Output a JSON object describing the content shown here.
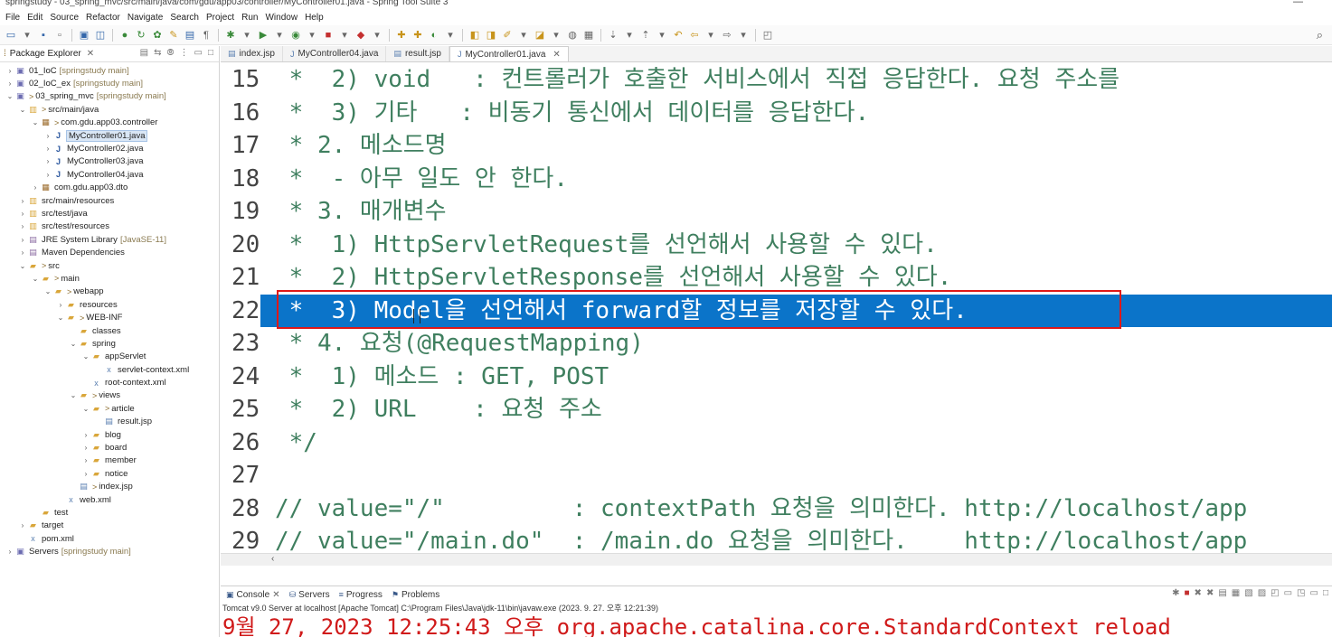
{
  "window": {
    "title": "springstudy - 03_spring_mvc/src/main/java/com/gdu/app03/controller/MyController01.java - Spring Tool Suite 3",
    "minimize": "—"
  },
  "menu": [
    "File",
    "Edit",
    "Source",
    "Refactor",
    "Navigate",
    "Search",
    "Project",
    "Run",
    "Window",
    "Help"
  ],
  "package_explorer": {
    "tab_label": "Package Explorer",
    "items": [
      {
        "label": "01_IoC",
        "meta": "[springstudy main]",
        "icon": "project-icon",
        "twisty": ">",
        "deco": ""
      },
      {
        "label": "02_IoC_ex",
        "meta": "[springstudy main]",
        "icon": "project-icon",
        "twisty": ">",
        "deco": ""
      },
      {
        "label": "03_spring_mvc",
        "meta": "[springstudy main]",
        "icon": "project-icon",
        "twisty": "v",
        "deco": ">"
      },
      {
        "label": "src/main/java",
        "meta": "",
        "icon": "source-folder-icon",
        "twisty": "v",
        "deco": ">"
      },
      {
        "label": "com.gdu.app03.controller",
        "meta": "",
        "icon": "package-icon",
        "twisty": "v",
        "deco": ">"
      },
      {
        "label": "MyController01.java",
        "meta": "",
        "icon": "java-file-icon",
        "twisty": ">",
        "deco": "",
        "selected": true
      },
      {
        "label": "MyController02.java",
        "meta": "",
        "icon": "java-file-icon",
        "twisty": ">",
        "deco": ""
      },
      {
        "label": "MyController03.java",
        "meta": "",
        "icon": "java-file-icon",
        "twisty": ">",
        "deco": ""
      },
      {
        "label": "MyController04.java",
        "meta": "",
        "icon": "java-file-icon",
        "twisty": ">",
        "deco": ""
      },
      {
        "label": "com.gdu.app03.dto",
        "meta": "",
        "icon": "package-icon",
        "twisty": ">",
        "deco": ""
      },
      {
        "label": "src/main/resources",
        "meta": "",
        "icon": "source-folder-icon",
        "twisty": ">",
        "deco": ""
      },
      {
        "label": "src/test/java",
        "meta": "",
        "icon": "source-folder-icon",
        "twisty": ">",
        "deco": ""
      },
      {
        "label": "src/test/resources",
        "meta": "",
        "icon": "source-folder-icon",
        "twisty": ">",
        "deco": ""
      },
      {
        "label": "JRE System Library",
        "meta": "[JavaSE-11]",
        "icon": "library-icon",
        "twisty": ">",
        "deco": ""
      },
      {
        "label": "Maven Dependencies",
        "meta": "",
        "icon": "library-icon",
        "twisty": ">",
        "deco": ""
      },
      {
        "label": "src",
        "meta": "",
        "icon": "folder-icon",
        "twisty": "v",
        "deco": ">"
      },
      {
        "label": "main",
        "meta": "",
        "icon": "folder-icon",
        "twisty": "v",
        "deco": ">"
      },
      {
        "label": "webapp",
        "meta": "",
        "icon": "folder-icon",
        "twisty": "v",
        "deco": ">"
      },
      {
        "label": "resources",
        "meta": "",
        "icon": "folder-icon",
        "twisty": ">",
        "deco": ""
      },
      {
        "label": "WEB-INF",
        "meta": "",
        "icon": "folder-icon",
        "twisty": "v",
        "deco": ">"
      },
      {
        "label": "classes",
        "meta": "",
        "icon": "folder-icon",
        "twisty": "",
        "deco": ""
      },
      {
        "label": "spring",
        "meta": "",
        "icon": "folder-icon",
        "twisty": "v",
        "deco": ""
      },
      {
        "label": "appServlet",
        "meta": "",
        "icon": "folder-icon",
        "twisty": "v",
        "deco": ""
      },
      {
        "label": "servlet-context.xml",
        "meta": "",
        "icon": "xml-file-icon",
        "twisty": "",
        "deco": ""
      },
      {
        "label": "root-context.xml",
        "meta": "",
        "icon": "xml-file-icon",
        "twisty": "",
        "deco": ""
      },
      {
        "label": "views",
        "meta": "",
        "icon": "folder-icon",
        "twisty": "v",
        "deco": ">"
      },
      {
        "label": "article",
        "meta": "",
        "icon": "folder-icon",
        "twisty": "v",
        "deco": ">"
      },
      {
        "label": "result.jsp",
        "meta": "",
        "icon": "jsp-file-icon",
        "twisty": "",
        "deco": ""
      },
      {
        "label": "blog",
        "meta": "",
        "icon": "folder-icon",
        "twisty": ">",
        "deco": ""
      },
      {
        "label": "board",
        "meta": "",
        "icon": "folder-icon",
        "twisty": ">",
        "deco": ""
      },
      {
        "label": "member",
        "meta": "",
        "icon": "folder-icon",
        "twisty": ">",
        "deco": ""
      },
      {
        "label": "notice",
        "meta": "",
        "icon": "folder-icon",
        "twisty": ">",
        "deco": ""
      },
      {
        "label": "index.jsp",
        "meta": "",
        "icon": "jsp-file-icon",
        "twisty": "",
        "deco": ">"
      },
      {
        "label": "web.xml",
        "meta": "",
        "icon": "xml-file-icon",
        "twisty": "",
        "deco": ""
      },
      {
        "label": "test",
        "meta": "",
        "icon": "folder-icon",
        "twisty": "",
        "deco": ""
      },
      {
        "label": "target",
        "meta": "",
        "icon": "folder-icon",
        "twisty": ">",
        "deco": ""
      },
      {
        "label": "pom.xml",
        "meta": "",
        "icon": "xml-file-icon",
        "twisty": "",
        "deco": ""
      },
      {
        "label": "Servers",
        "meta": "[springstudy main]",
        "icon": "project-icon",
        "twisty": ">",
        "deco": ""
      }
    ]
  },
  "editor": {
    "tabs": [
      {
        "label": "index.jsp",
        "active": false
      },
      {
        "label": "MyController04.java",
        "active": false
      },
      {
        "label": "result.jsp",
        "active": false
      },
      {
        "label": "MyController01.java",
        "active": true
      }
    ],
    "lines": [
      {
        "n": "15",
        "text": " *  2) void   : 컨트롤러가 호출한 서비스에서 직접 응답한다. 요청 주소를 ",
        "hl": false
      },
      {
        "n": "16",
        "text": " *  3) 기타   : 비동기 통신에서 데이터를 응답한다.",
        "hl": false
      },
      {
        "n": "17",
        "text": " * 2. 메소드명",
        "hl": false
      },
      {
        "n": "18",
        "text": " *  - 아무 일도 안 한다.",
        "hl": false
      },
      {
        "n": "19",
        "text": " * 3. 매개변수",
        "hl": false
      },
      {
        "n": "20",
        "text": " *  1) HttpServletRequest를 선언해서 사용할 수 있다.",
        "hl": false
      },
      {
        "n": "21",
        "text": " *  2) HttpServletResponse를 선언해서 사용할 수 있다.",
        "hl": false
      },
      {
        "n": "22",
        "text": " *  3) Model을 선언해서 forward할 정보를 저장할 수 있다.",
        "hl": true
      },
      {
        "n": "23",
        "text": " * 4. 요청(@RequestMapping)",
        "hl": false
      },
      {
        "n": "24",
        "text": " *  1) 메소드 : GET, POST",
        "hl": false
      },
      {
        "n": "25",
        "text": " *  2) URL    : 요청 주소",
        "hl": false
      },
      {
        "n": "26",
        "text": " */",
        "hl": false
      },
      {
        "n": "27",
        "text": "",
        "hl": false
      },
      {
        "n": "28",
        "text": "// value=\"/\"         : contextPath 요청을 의미한다. http://localhost/app",
        "hl": false
      },
      {
        "n": "29",
        "text": "// value=\"/main.do\"  : /main.do 요청을 의미한다.    http://localhost/app",
        "hl": false
      }
    ]
  },
  "console": {
    "tabs": [
      "Console",
      "Servers",
      "Progress",
      "Problems"
    ],
    "status": "Tomcat v9.0 Server at localhost [Apache Tomcat] C:\\Program Files\\Java\\jdk-11\\bin\\javaw.exe  (2023. 9. 27. 오후 12:21:39)",
    "output": "9월 27, 2023 12:25:43 오후 org.apache.catalina.core.StandardContext reload"
  }
}
